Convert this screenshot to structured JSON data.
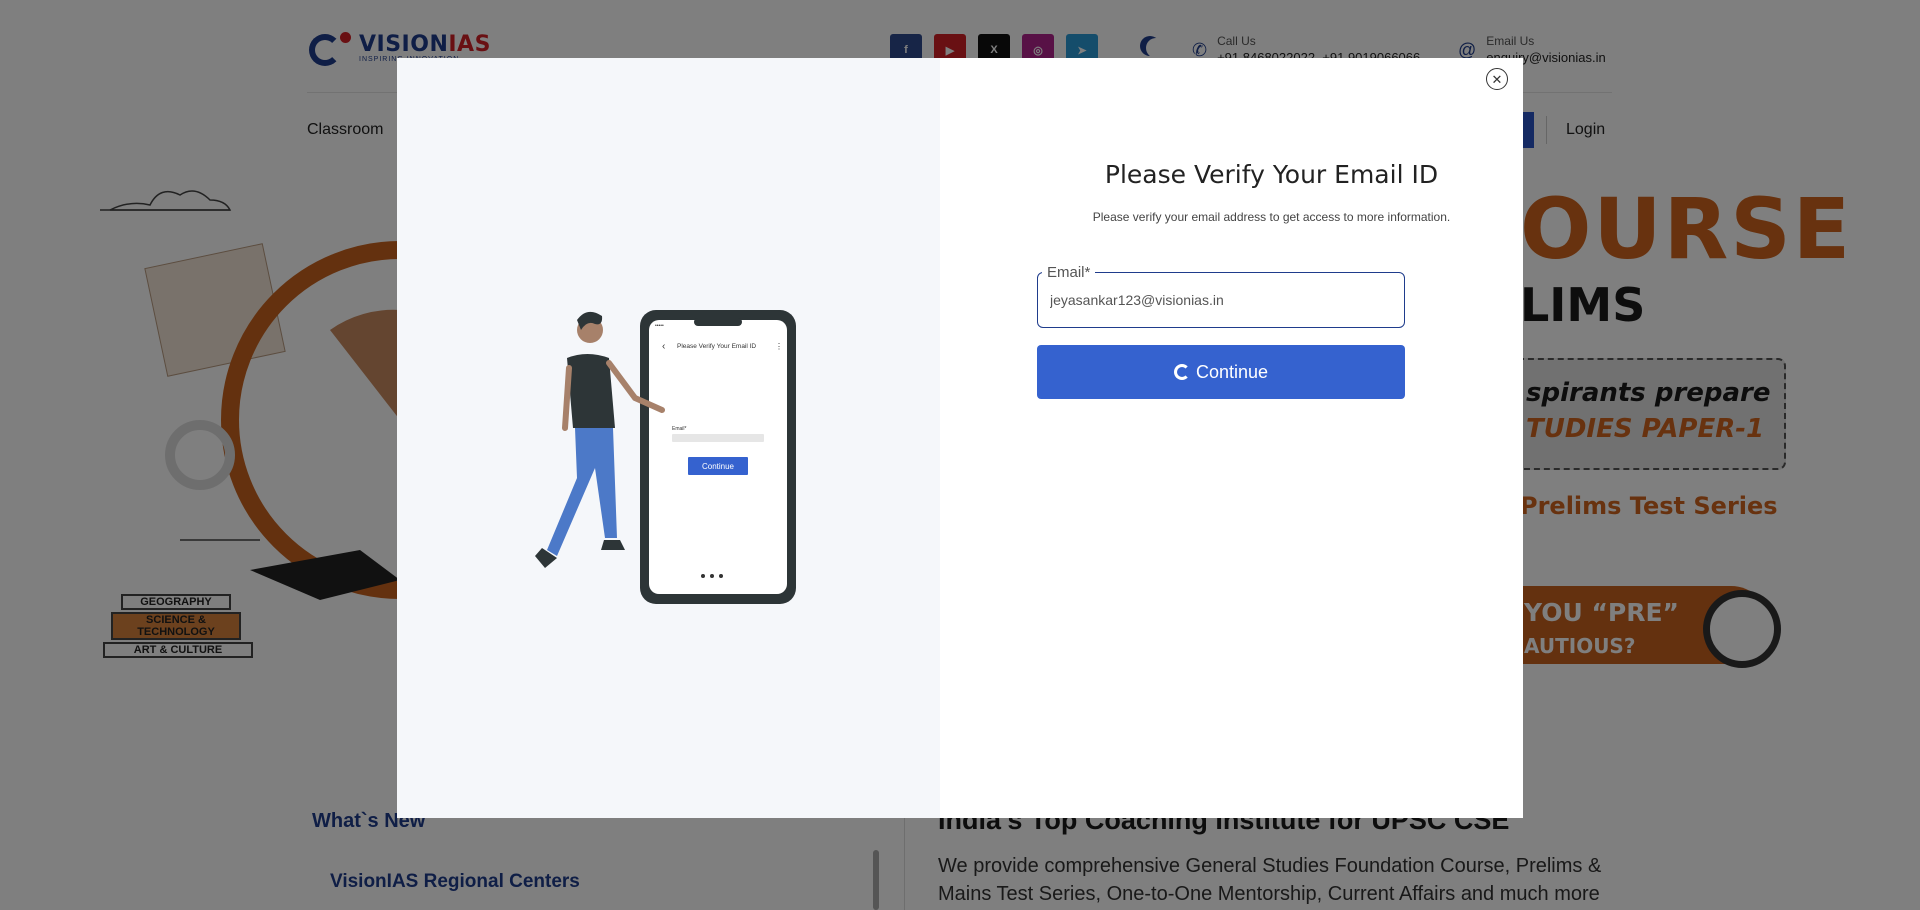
{
  "header": {
    "logo_name": "VISION",
    "logo_name_accent": "IAS",
    "logo_tagline": "INSPIRING INNOVATION",
    "socials": [
      {
        "icon": "facebook-icon",
        "glyph": "f",
        "color": "#2f4b8f"
      },
      {
        "icon": "youtube-icon",
        "glyph": "▶",
        "color": "#d32027"
      },
      {
        "icon": "x-icon",
        "glyph": "𝕏",
        "color": "#111111"
      },
      {
        "icon": "instagram-icon",
        "glyph": "◎",
        "color": "#b0228c"
      },
      {
        "icon": "telegram-icon",
        "glyph": "➤",
        "color": "#2a9bd6"
      }
    ],
    "call_label": "Call Us",
    "call_value": "+91 8468022022, +91 9019066066",
    "email_label": "Email Us",
    "email_value": "enquiry@visionias.in",
    "nav_classroom": "Classroom",
    "login": "Login"
  },
  "hero": {
    "big": "OURSE",
    "lims": "LIMS",
    "box_line1": "spirants prepare",
    "box_line2": "TUDIES PAPER-1",
    "series": "Prelims Test Series",
    "pre_line1": "YOU “PRE”",
    "pre_line2": "AUTIOUS?",
    "books": [
      "GEOGRAPHY",
      "SCIENCE & TECHNOLOGY",
      "ART & CULTURE"
    ]
  },
  "content": {
    "whats_new": "What`s New",
    "regional": "VisionIAS Regional Centers",
    "india_title": "India's Top Coaching Institute for UPSC CSE",
    "india_desc": "We provide comprehensive General Studies Foundation Course, Prelims & Mains Test Series, One-to-One Mentorship, Current Affairs and much more"
  },
  "modal": {
    "title": "Please Verify Your Email ID",
    "subtitle": "Please verify your email address to get access to more information.",
    "email_label": "Email*",
    "email_value": "jeyasankar123@visionias.in",
    "continue_label": "Continue",
    "phone_title": "Please Verify Your Email ID",
    "phone_email_label": "Email*",
    "phone_continue": "Continue"
  },
  "colors": {
    "brand_blue": "#1f3c8c",
    "button_blue": "#3562cf",
    "brand_orange": "#d0651e"
  }
}
